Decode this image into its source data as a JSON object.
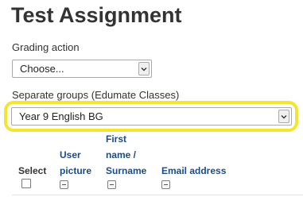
{
  "page": {
    "title": "Test Assignment"
  },
  "grading_action": {
    "label": "Grading action",
    "selected": "Choose..."
  },
  "separate_groups": {
    "label": "Separate groups (Edumate Classes)",
    "selected": "Year 9 English BG",
    "highlight_color": "#f2e533"
  },
  "table": {
    "columns": {
      "select": "Select",
      "user_picture_line1": "User",
      "user_picture_line2": "picture",
      "name_line1": "First",
      "name_line2": "name /",
      "name_line3": "Surname",
      "email": "Email address"
    },
    "link_color": "#1a4b8c"
  },
  "icons": {
    "dropdown": "chevron-down-icon",
    "collapse": "collapse-column-icon"
  }
}
